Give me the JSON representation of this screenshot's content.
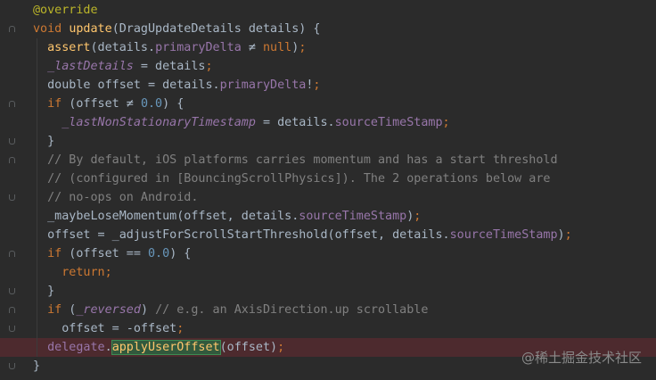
{
  "editor": {
    "colors": {
      "background": "#2b2b2b",
      "keyword": "#cc7832",
      "function": "#ffc66d",
      "field": "#9876aa",
      "number": "#6897bb",
      "comment": "#808080",
      "annotation": "#bbb529",
      "error_line": "#4d2a2e"
    },
    "lines": [
      {
        "tokens": [
          [
            "annotation",
            "@override"
          ]
        ]
      },
      {
        "fold": "start",
        "tokens": [
          [
            "keyword",
            "void "
          ],
          [
            "function",
            "update"
          ],
          [
            "plain",
            "(DragUpdateDetails details) {"
          ]
        ]
      },
      {
        "tokens": [
          [
            "plain",
            "  "
          ],
          [
            "function",
            "assert"
          ],
          [
            "plain",
            "(details."
          ],
          [
            "field",
            "primaryDelta"
          ],
          [
            "plain",
            " ≠ "
          ],
          [
            "keyword",
            "null"
          ],
          [
            "plain",
            ")"
          ],
          [
            "punct",
            ";"
          ]
        ]
      },
      {
        "tokens": [
          [
            "plain",
            "  "
          ],
          [
            "private",
            "_lastDetails"
          ],
          [
            "plain",
            " = details"
          ],
          [
            "punct",
            ";"
          ]
        ]
      },
      {
        "tokens": [
          [
            "plain",
            "  double offset = details."
          ],
          [
            "field",
            "primaryDelta"
          ],
          [
            "plain",
            "!"
          ],
          [
            "punct",
            ";"
          ]
        ]
      },
      {
        "fold": "start",
        "tokens": [
          [
            "plain",
            "  "
          ],
          [
            "keyword",
            "if"
          ],
          [
            "plain",
            " (offset ≠ "
          ],
          [
            "number",
            "0.0"
          ],
          [
            "plain",
            ") {"
          ]
        ]
      },
      {
        "tokens": [
          [
            "plain",
            "    "
          ],
          [
            "private",
            "_lastNonStationaryTimestamp"
          ],
          [
            "plain",
            " = details."
          ],
          [
            "field",
            "sourceTimeStamp"
          ],
          [
            "punct",
            ";"
          ]
        ]
      },
      {
        "fold": "end",
        "tokens": [
          [
            "plain",
            "  }"
          ]
        ]
      },
      {
        "fold": "start",
        "tokens": [
          [
            "plain",
            "  "
          ],
          [
            "comment",
            "// By default, iOS platforms carries momentum and has a start threshold"
          ]
        ]
      },
      {
        "tokens": [
          [
            "plain",
            "  "
          ],
          [
            "comment",
            "// (configured in [BouncingScrollPhysics]). The 2 operations below are"
          ]
        ]
      },
      {
        "fold": "end",
        "tokens": [
          [
            "plain",
            "  "
          ],
          [
            "comment",
            "// no-ops on Android."
          ]
        ]
      },
      {
        "tokens": [
          [
            "plain",
            "  _maybeLoseMomentum(offset, details."
          ],
          [
            "field",
            "sourceTimeStamp"
          ],
          [
            "plain",
            ")"
          ],
          [
            "punct",
            ";"
          ]
        ]
      },
      {
        "tokens": [
          [
            "plain",
            "  offset = _adjustForScrollStartThreshold(offset, details."
          ],
          [
            "field",
            "sourceTimeStamp"
          ],
          [
            "plain",
            ")"
          ],
          [
            "punct",
            ";"
          ]
        ]
      },
      {
        "fold": "start",
        "tokens": [
          [
            "plain",
            "  "
          ],
          [
            "keyword",
            "if"
          ],
          [
            "plain",
            " (offset == "
          ],
          [
            "number",
            "0.0"
          ],
          [
            "plain",
            ") {"
          ]
        ]
      },
      {
        "tokens": [
          [
            "plain",
            "    "
          ],
          [
            "keyword",
            "return"
          ],
          [
            "punct",
            ";"
          ]
        ]
      },
      {
        "fold": "end",
        "tokens": [
          [
            "plain",
            "  }"
          ]
        ]
      },
      {
        "fold": "start",
        "tokens": [
          [
            "plain",
            "  "
          ],
          [
            "keyword",
            "if"
          ],
          [
            "plain",
            " ("
          ],
          [
            "private",
            "_reversed"
          ],
          [
            "plain",
            ") "
          ],
          [
            "comment",
            "// e.g. an AxisDirection.up scrollable"
          ]
        ]
      },
      {
        "fold": "end",
        "tokens": [
          [
            "plain",
            "    offset = -offset"
          ],
          [
            "punct",
            ";"
          ]
        ]
      },
      {
        "error": true,
        "tokens": [
          [
            "plain",
            "  "
          ],
          [
            "field",
            "delegate"
          ],
          [
            "plain",
            "."
          ],
          [
            "highlight",
            "applyUserOffset"
          ],
          [
            "plain",
            "(offset)"
          ],
          [
            "punct",
            ";"
          ]
        ]
      },
      {
        "fold": "end",
        "tokens": [
          [
            "plain",
            "}"
          ]
        ]
      }
    ]
  },
  "watermark": "@稀土掘金技术社区"
}
